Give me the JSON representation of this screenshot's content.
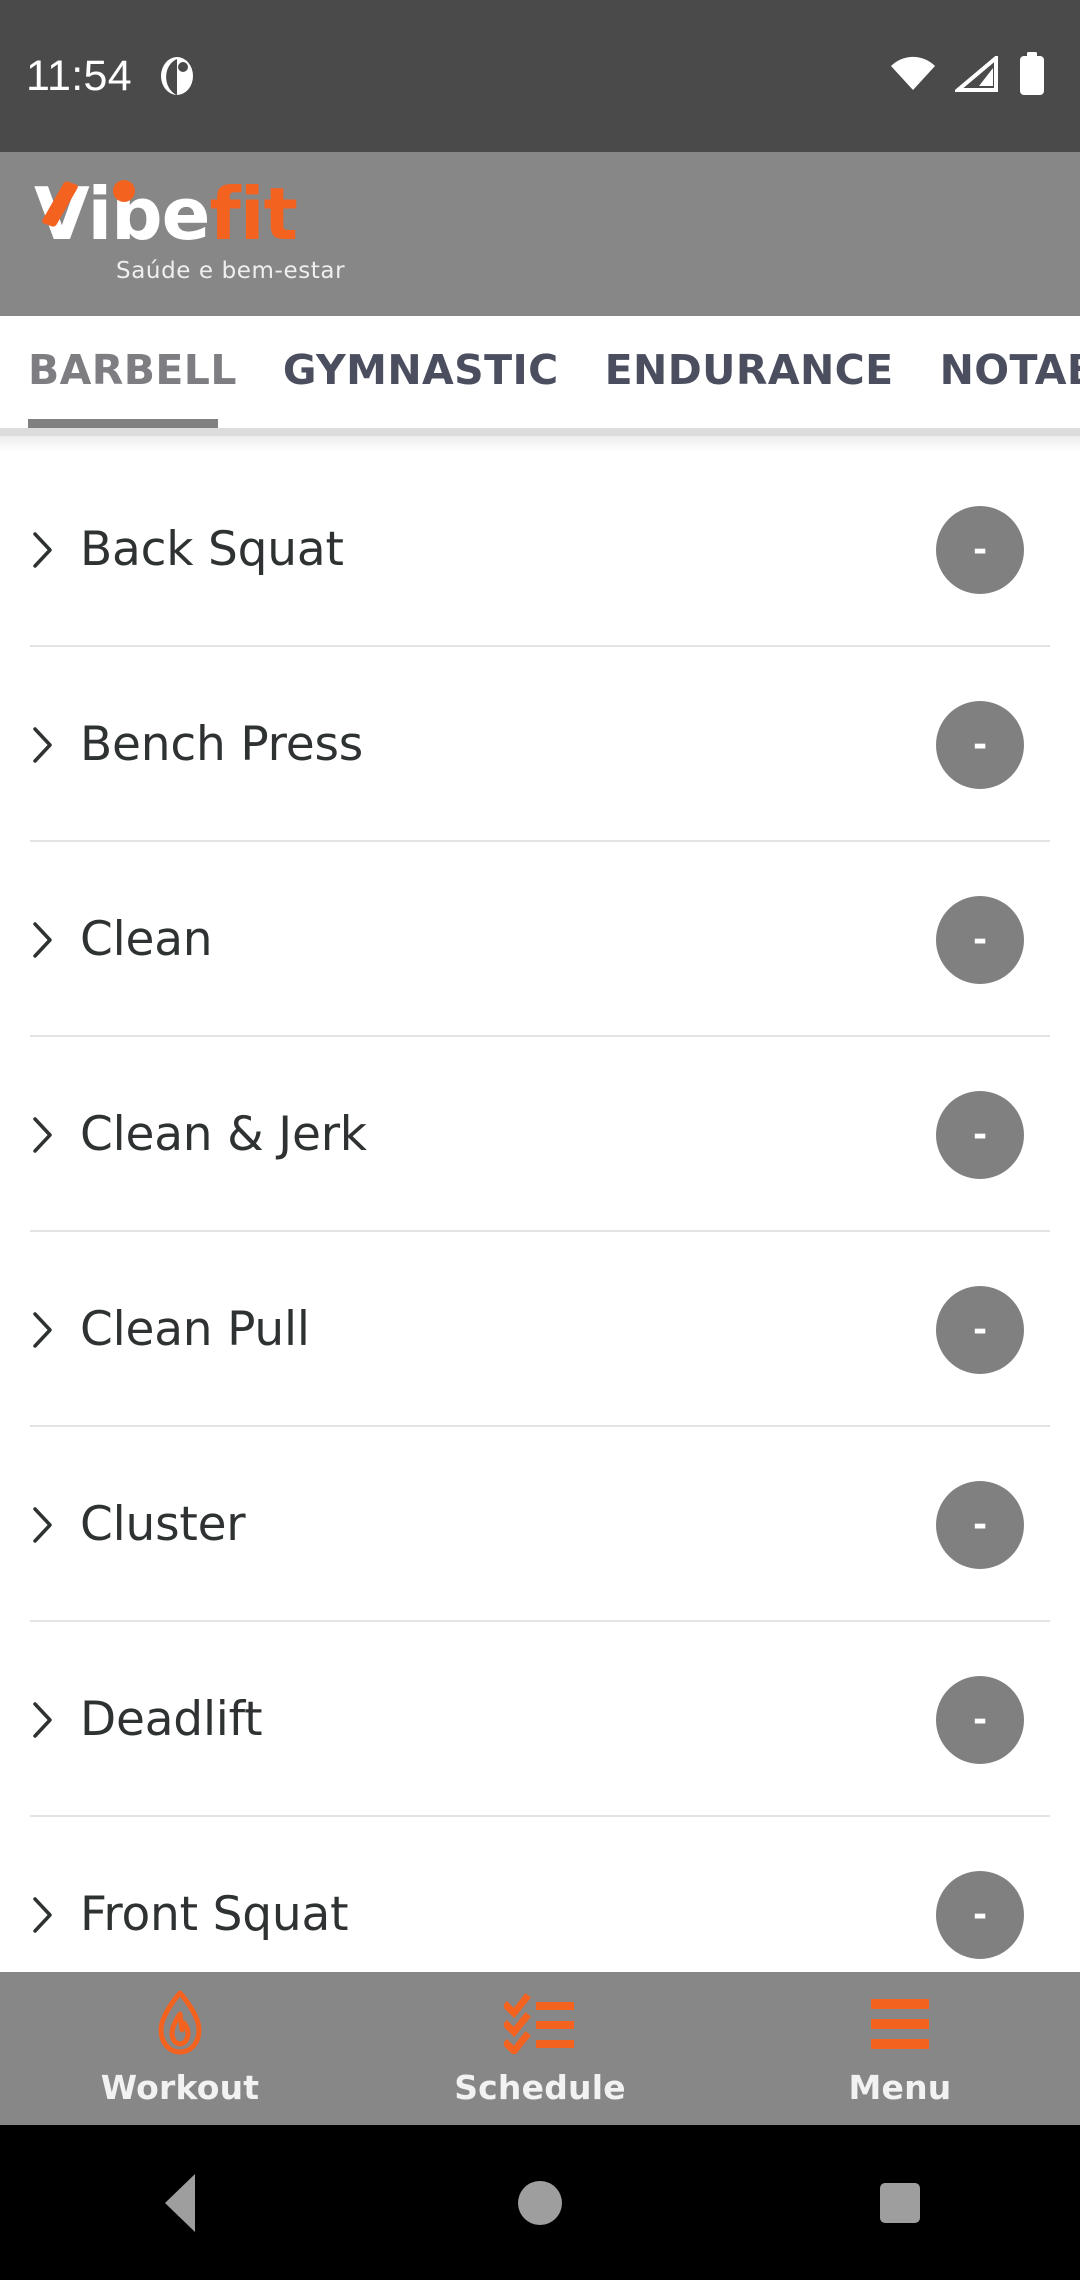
{
  "status_bar": {
    "clock": "11:54",
    "notification_icon": "app-notification-icon",
    "wifi_icon": "wifi-full-icon",
    "cellular_icon": "cellular-signal-icon",
    "battery_icon": "battery-full-icon",
    "background_color": "#4a4a4a"
  },
  "app_header": {
    "logo_primary": "Vibe",
    "logo_accent": "fit",
    "tagline": "Saúde e bem-estar",
    "background_color": "#878787",
    "accent_color": "#F4621F"
  },
  "tabs": {
    "items": [
      {
        "label": "BARBELL",
        "active": true
      },
      {
        "label": "GYMNASTIC",
        "active": false
      },
      {
        "label": "ENDURANCE",
        "active": false
      },
      {
        "label": "NOTABLES",
        "active": false
      }
    ],
    "active_color": "#7d7d82",
    "inactive_color": "#4a4e5e",
    "indicator_color": "#808080"
  },
  "exercise_list": {
    "badge_color": "#808080",
    "rows": [
      {
        "name": "Back Squat",
        "badge": "-"
      },
      {
        "name": "Bench Press",
        "badge": "-"
      },
      {
        "name": "Clean",
        "badge": "-"
      },
      {
        "name": "Clean & Jerk",
        "badge": "-"
      },
      {
        "name": "Clean Pull",
        "badge": "-"
      },
      {
        "name": "Cluster",
        "badge": "-"
      },
      {
        "name": "Deadlift",
        "badge": "-"
      },
      {
        "name": "Front Squat",
        "badge": "-"
      }
    ]
  },
  "bottom_nav": {
    "background_color": "#878787",
    "icon_color": "#F4621F",
    "items": [
      {
        "label": "Workout",
        "icon": "flame-icon"
      },
      {
        "label": "Schedule",
        "icon": "checklist-icon"
      },
      {
        "label": "Menu",
        "icon": "hamburger-menu-icon"
      }
    ]
  },
  "android_nav": {
    "back": "back-triangle-icon",
    "home": "home-circle-icon",
    "recents": "recents-square-icon"
  }
}
